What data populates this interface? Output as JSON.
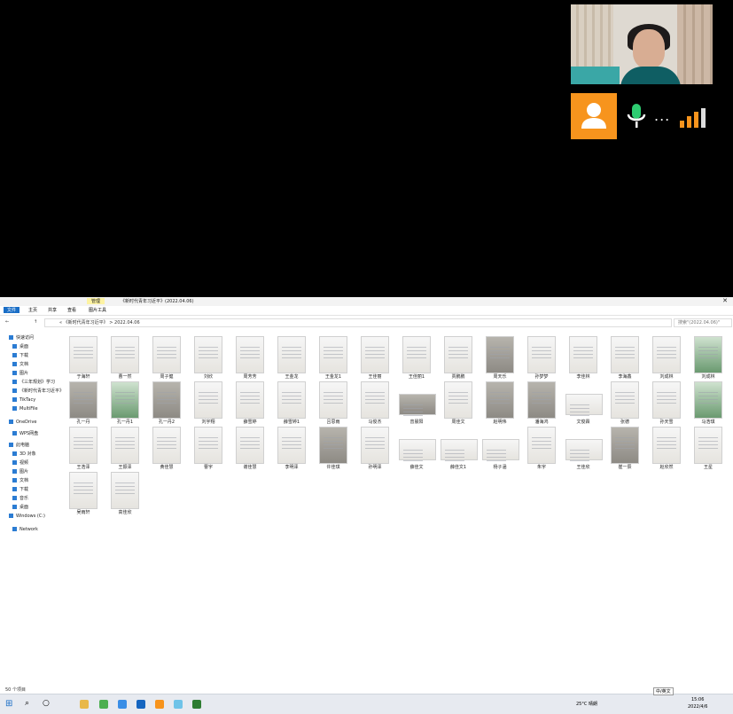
{
  "meeting": {
    "more_label": "..."
  },
  "explorer": {
    "title_tab": "管理",
    "title": "《新时代青年习近平》(2022.04.06)",
    "ribbon": [
      "文件",
      "主页",
      "共享",
      "查看",
      "图片工具"
    ],
    "path": "« 《新时代青年习近平》 > 2022.04.06",
    "search_placeholder": "搜索\"(2022.04.06)\"",
    "nav": [
      {
        "label": "快速访问"
      },
      {
        "label": "桌面"
      },
      {
        "label": "下载"
      },
      {
        "label": "文档"
      },
      {
        "label": "图片"
      },
      {
        "label": "《三年规划》学习"
      },
      {
        "label": "《新时代青年习近平》"
      },
      {
        "label": "TikTacy"
      },
      {
        "label": "MultiFile"
      },
      {
        "label": "OneDrive"
      },
      {
        "label": "WPS网盘"
      },
      {
        "label": "此电脑"
      },
      {
        "label": "3D 对象"
      },
      {
        "label": "视频"
      },
      {
        "label": "图片"
      },
      {
        "label": "文档"
      },
      {
        "label": "下载"
      },
      {
        "label": "音乐"
      },
      {
        "label": "桌面"
      },
      {
        "label": "Windows (C:)"
      },
      {
        "label": "Network"
      }
    ],
    "files": [
      {
        "label": "于海轩"
      },
      {
        "label": "曹一然"
      },
      {
        "label": "周子健"
      },
      {
        "label": "刘欣"
      },
      {
        "label": "周芳芳"
      },
      {
        "label": "王金龙"
      },
      {
        "label": "王金龙1"
      },
      {
        "label": "王佳丽"
      },
      {
        "label": "王佳丽1"
      },
      {
        "label": "贾鹏鹏"
      },
      {
        "label": "周天乐"
      },
      {
        "label": "孙梦梦"
      },
      {
        "label": "李佳林"
      },
      {
        "label": "李海鑫"
      },
      {
        "label": "刘成林"
      },
      {
        "label": "刘成林",
        "x": 0
      },
      {
        "label": "孔一丹"
      },
      {
        "label": "孔一丹1"
      },
      {
        "label": "孔一丹2"
      },
      {
        "label": "刘宇翔"
      },
      {
        "label": "薛雪婷"
      },
      {
        "label": "薛雪婷1"
      },
      {
        "label": "吕思雨"
      },
      {
        "label": "马俊杰"
      },
      {
        "label": "曾晨阳"
      },
      {
        "label": "周佳文"
      },
      {
        "label": "赵明伟"
      },
      {
        "label": "潘海鸿"
      },
      {
        "label": "文俊霖"
      },
      {
        "label": "张德"
      },
      {
        "label": "孙天雪"
      },
      {
        "label": "马浩琪"
      },
      {
        "label": "王浩泽"
      },
      {
        "label": "王振泽"
      },
      {
        "label": "黄佳慧"
      },
      {
        "label": "曹宇"
      },
      {
        "label": "谢佳慧"
      },
      {
        "label": "李明泽"
      },
      {
        "label": "许佳琪"
      },
      {
        "label": "孙明泽"
      },
      {
        "label": "薛佳文"
      },
      {
        "label": "薛佳文1"
      },
      {
        "label": "杨子涵"
      },
      {
        "label": "朱宇"
      },
      {
        "label": "王佳欣"
      },
      {
        "label": "崔一辰"
      },
      {
        "label": "赵欣然"
      },
      {
        "label": "王星"
      },
      {
        "label": "吴雨轩"
      },
      {
        "label": "高佳欣"
      }
    ],
    "status": "50 个项目"
  },
  "taskbar": {
    "weather": "25°C 晴朗",
    "ime": "中/英文",
    "time": "15:06",
    "date": "2022/4/6"
  }
}
